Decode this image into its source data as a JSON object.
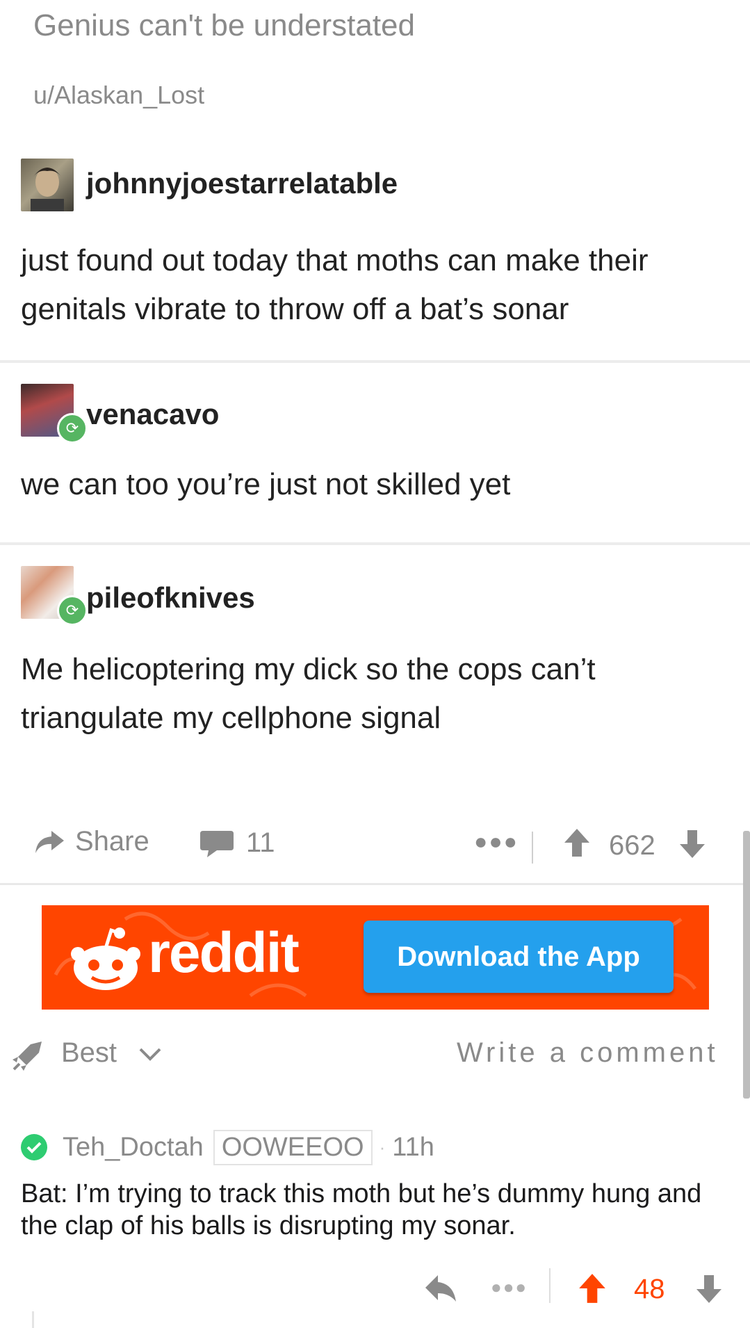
{
  "post": {
    "title": "Genius can't be understated",
    "author": "u/Alaskan_Lost"
  },
  "tumblr": {
    "posts": [
      {
        "username": "johnnyjoestarrelatable",
        "text": "just found out today that moths can make their genitals vibrate to throw off a bat’s sonar",
        "reblog": false
      },
      {
        "username": "venacavo",
        "text": "we can too you’re just not skilled yet",
        "reblog": true
      },
      {
        "username": "pileofknives",
        "text": "Me helicoptering my dick so the cops can’t triangulate my cellphone signal",
        "reblog": true
      }
    ]
  },
  "action_bar": {
    "share_label": "Share",
    "comment_count": "11",
    "score": "662",
    "more_icon": "ellipsis-icon"
  },
  "banner": {
    "brand": "reddit",
    "button_label": "Download the App",
    "bg_color": "#ff4500",
    "button_color": "#24a0ed"
  },
  "sort": {
    "label": "Best",
    "write_comment": "Write a comment"
  },
  "comment": {
    "author": "Teh_Doctah",
    "flair": "OOWEEOO",
    "separator": "·",
    "age": "11h",
    "text": "Bat: I’m trying to track this moth but he’s dummy hung and the clap of his balls is disrupting my sonar.",
    "score": "48",
    "upvote_color": "#ff4500"
  }
}
